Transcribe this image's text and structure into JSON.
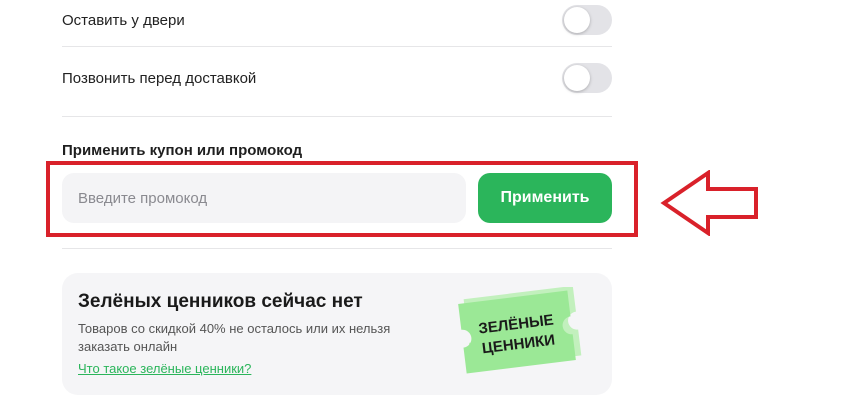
{
  "options": {
    "leave_at_door": {
      "label": "Оставить у двери",
      "enabled": false
    },
    "call_before_delivery": {
      "label": "Позвонить перед доставкой",
      "enabled": false
    }
  },
  "coupon": {
    "heading": "Применить купон или промокод",
    "input_value": "",
    "input_placeholder": "Введите промокод",
    "apply_label": "Применить"
  },
  "green_prices": {
    "title": "Зелёных ценников сейчас нет",
    "description": "Товаров со скидкой 40% не осталось или их нельзя заказать онлайн",
    "link_label": "Что такое зелёные ценники?",
    "badge_line1": "ЗЕЛЁНЫЕ",
    "badge_line2": "ЦЕННИКИ"
  },
  "colors": {
    "accent_green": "#2bb55b",
    "highlight_red": "#d9212a",
    "badge_green": "#9be896"
  },
  "icons": {
    "arrow": "arrow-left-outline-icon",
    "badge": "green-price-tag-icon"
  }
}
